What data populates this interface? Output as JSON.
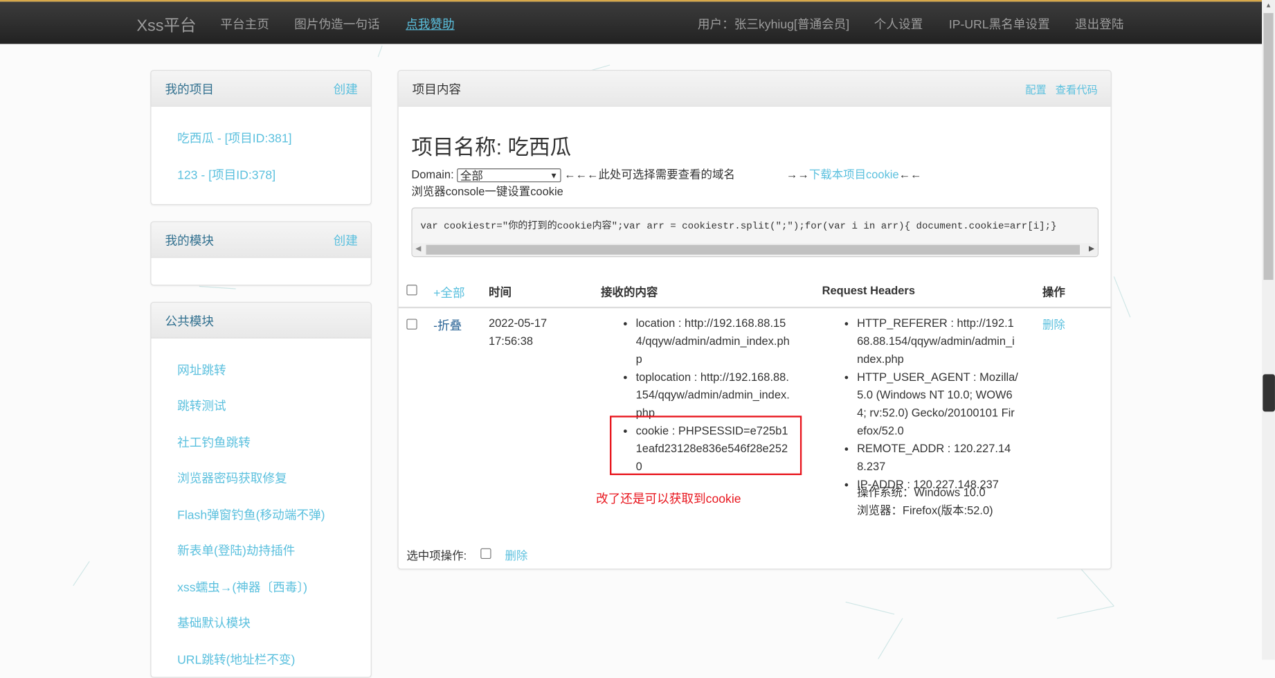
{
  "navbar": {
    "brand": "Xss平台",
    "links": [
      "平台主页",
      "图片伪造一句话",
      "点我赞助"
    ],
    "user": "用户：张三kyhiug[普通会员]",
    "right_links": [
      "个人设置",
      "IP-URL黑名单设置",
      "退出登陆"
    ]
  },
  "sidebar": {
    "projects": {
      "title": "我的项目",
      "create": "创建",
      "items": [
        "吃西瓜 - [项目ID:381]",
        "123 - [项目ID:378]"
      ]
    },
    "modules": {
      "title": "我的模块",
      "create": "创建"
    },
    "public": {
      "title": "公共模块",
      "items": [
        "网址跳转",
        "跳转测试",
        "社工钓鱼跳转",
        "浏览器密码获取修复",
        "Flash弹窗钓鱼(移动端不弹)",
        "新表单(登陆)劫持插件",
        "xss蠕虫→(神器〔西毒〕)",
        "基础默认模块",
        "URL跳转(地址栏不变)"
      ]
    }
  },
  "main": {
    "header": "项目内容",
    "config": "配置",
    "view_code": "查看代码",
    "title": "项目名称: 吃西瓜",
    "domain_label": "Domain:",
    "domain_value": "全部",
    "domain_hint": "←←←此处可选择需要查看的域名",
    "download_prefix": "→→",
    "download_link": "下载本项目cookie",
    "download_suffix": "←←",
    "console_hint": "浏览器console一键设置cookie",
    "code": "var cookiestr=\"你的打到的cookie内容\";var arr = cookiestr.split(\";\");for(var i in arr){ document.cookie=arr[i];}",
    "table": {
      "headers": {
        "all": "+全部",
        "time": "时间",
        "content": "接收的内容",
        "headers": "Request Headers",
        "action": "操作"
      },
      "rows": [
        {
          "toggle": "-折叠",
          "date": "2022-05-17",
          "time": "17:56:38",
          "content": [
            "location : http://192.168.88.154/qqyw/admin/admin_index.php",
            "toplocation : http://192.168.88.154/qqyw/admin/admin_index.php",
            "cookie : PHPSESSID=e725b11eafd23128e836e546f28e2520"
          ],
          "headers": [
            "HTTP_REFERER : http://192.168.88.154/qqyw/admin/admin_index.php",
            "HTTP_USER_AGENT : Mozilla/5.0 (Windows NT 10.0; WOW64; rv:52.0) Gecko/20100101 Firefox/52.0",
            "REMOTE_ADDR : 120.227.148.237",
            "IP-ADDR : 120.227.148.237"
          ],
          "os": "操作系统：Windows 10.0",
          "browser": "浏览器：Firefox(版本:52.0)",
          "delete": "删除"
        }
      ]
    },
    "annotation": "改了还是可以获取到cookie",
    "bulk_label": "选中项操作:",
    "bulk_delete": "删除"
  }
}
